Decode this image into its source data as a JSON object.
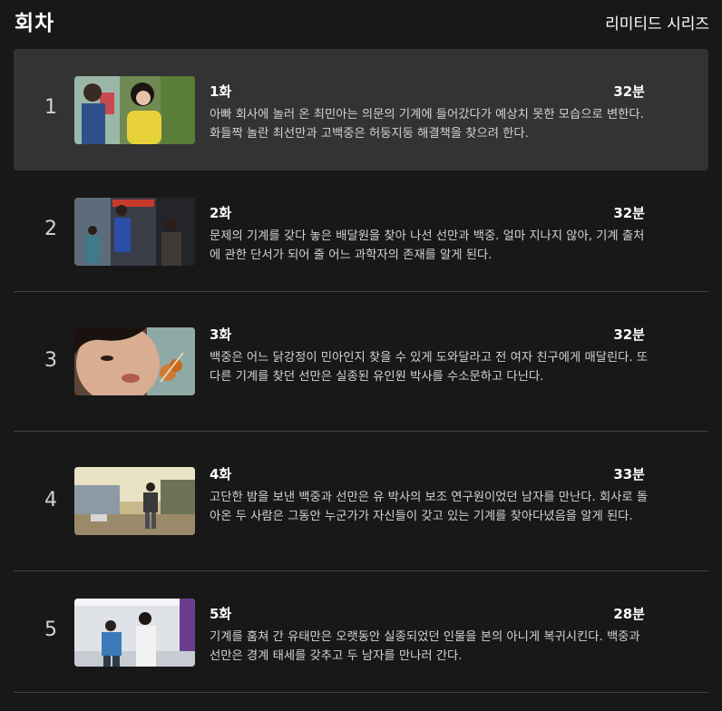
{
  "header": {
    "title": "회차",
    "badge": "리미티드 시리즈"
  },
  "episodes": [
    {
      "number": "1",
      "title": "1화",
      "duration": "32분",
      "description": "아빠 회사에 놀러 온 최민아는 의문의 기계에 들어갔다가 예상치 못한 모습으로 변한다. 화들짝 놀란 최선만과 고백중은 허둥지둥 해결책을 찾으려 한다.",
      "active": true
    },
    {
      "number": "2",
      "title": "2화",
      "duration": "32분",
      "description": "문제의 기계를 갖다 놓은 배달원을 찾아 나선 선만과 백중. 얼마 지나지 않아, 기계 출처에 관한 단서가 되어 줄 어느 과학자의 존재를 알게 된다."
    },
    {
      "number": "3",
      "title": "3화",
      "duration": "32분",
      "description": "백중은 어느 닭강정이 민아인지 찾을 수 있게 도와달라고 전 여자 친구에게 매달린다. 또 다른 기계를 찾던 선만은 실종된 유인원 박사를 수소문하고 다닌다."
    },
    {
      "number": "4",
      "title": "4화",
      "duration": "33분",
      "description": "고단한 밤을 보낸 백중과 선만은 유 박사의 보조 연구원이었던 남자를 만난다. 회사로 돌아온 두 사람은 그동안 누군가가 자신들이 갖고 있는 기계를 찾아다녔음을 알게 된다."
    },
    {
      "number": "5",
      "title": "5화",
      "duration": "28분",
      "description": "기계를 훔쳐 간 유태만은 오랫동안 실종되었던 인물을 본의 아니게 복귀시킨다. 백중과 선만은 경계 태세를 갖추고 두 남자를 만나러 간다."
    }
  ]
}
